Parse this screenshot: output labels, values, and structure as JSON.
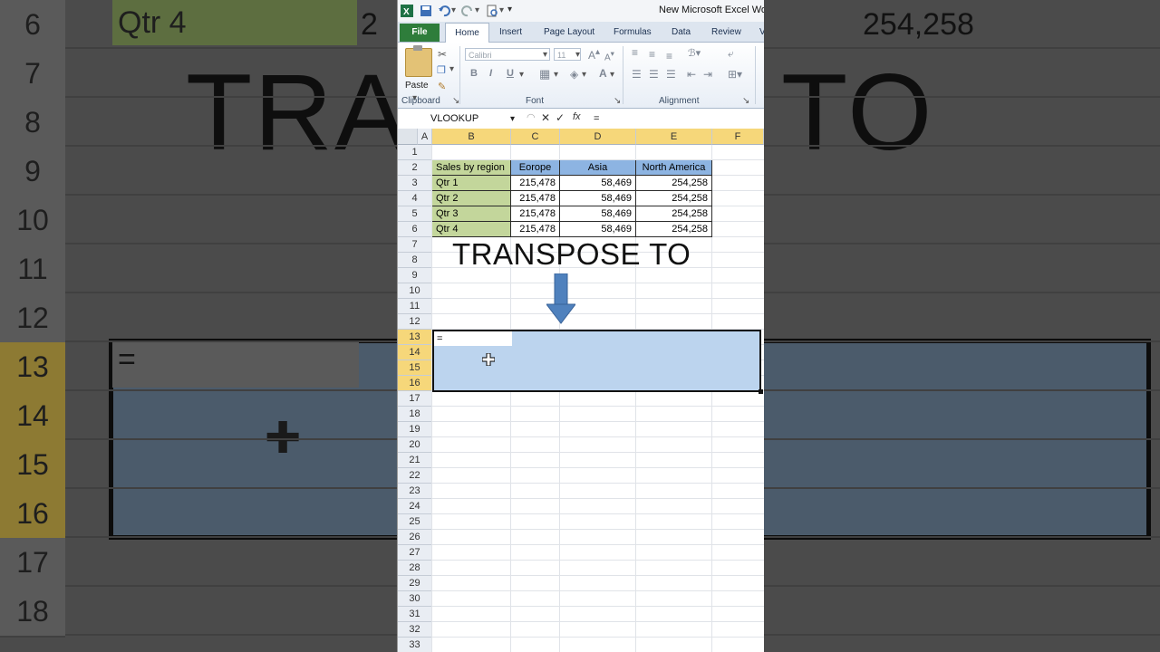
{
  "background": {
    "row_numbers": [
      "6",
      "7",
      "8",
      "9",
      "10",
      "11",
      "12",
      "13",
      "14",
      "15",
      "16",
      "17",
      "18"
    ],
    "cell_left": "Qtr 4",
    "cell_mid": "2",
    "cell_right": "254,258",
    "big_left": "TRA",
    "big_right": "TO",
    "sel_cell": "="
  },
  "window": {
    "title": "New Microsoft Excel Wor",
    "tabs": [
      "File",
      "Home",
      "Insert",
      "Page Layout",
      "Formulas",
      "Data",
      "Review",
      "V"
    ]
  },
  "ribbon": {
    "clipboard_label": "Clipboard",
    "paste_label": "Paste",
    "font_label": "Font",
    "alignment_label": "Alignment",
    "font_name": "Calibri",
    "font_size": "11",
    "bold": "B",
    "italic": "I",
    "underline": "U"
  },
  "formula_bar": {
    "name_box": "VLOOKUP",
    "fx": "fx",
    "formula": "="
  },
  "grid": {
    "columns": [
      "A",
      "B",
      "C",
      "D",
      "E",
      "F"
    ],
    "rows": [
      "1",
      "2",
      "3",
      "4",
      "5",
      "6",
      "7",
      "8",
      "9",
      "10",
      "11",
      "12",
      "13",
      "14",
      "15",
      "16",
      "17",
      "18",
      "19",
      "20",
      "21",
      "22",
      "23",
      "24",
      "25",
      "26",
      "27",
      "28",
      "29",
      "30",
      "31",
      "32",
      "33"
    ],
    "header_row": [
      "Sales by region",
      "Eorope",
      "Asia",
      "North America"
    ],
    "data_rows": [
      {
        "label": "Qtr 1",
        "values": [
          "215,478",
          "58,469",
          "254,258"
        ]
      },
      {
        "label": "Qtr 2",
        "values": [
          "215,478",
          "58,469",
          "254,258"
        ]
      },
      {
        "label": "Qtr 3",
        "values": [
          "215,478",
          "58,469",
          "254,258"
        ]
      },
      {
        "label": "Qtr 4",
        "values": [
          "215,478",
          "58,469",
          "254,258"
        ]
      }
    ],
    "active_cell_value": "="
  },
  "overlay": {
    "caption": "TRANSPOSE TO"
  },
  "colors": {
    "region_green": "#c3d69b",
    "header_blue": "#8db4e2",
    "selection_blue": "#bcd4ee",
    "arrow_blue": "#4f81bd",
    "file_tab": "#2e7d3b"
  }
}
